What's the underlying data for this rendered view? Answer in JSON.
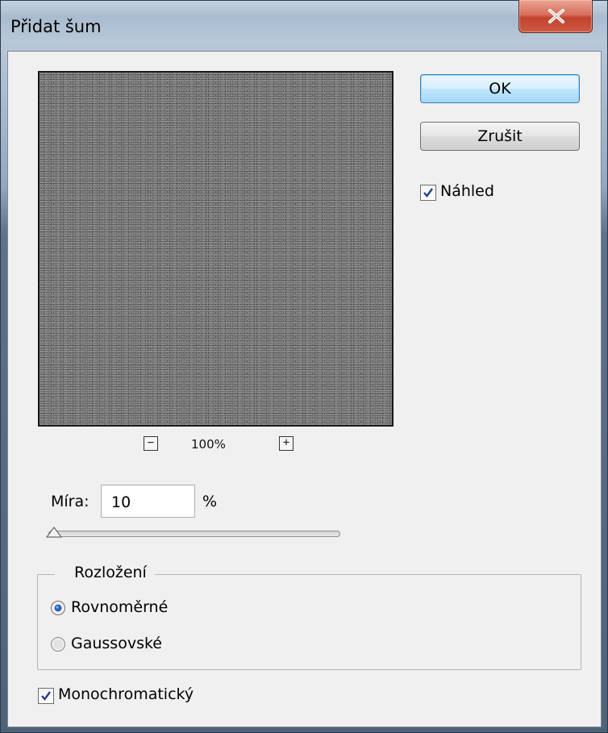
{
  "window": {
    "title": "Přidat šum"
  },
  "preview": {
    "zoom_level": "100%",
    "zoom_out": "−",
    "zoom_in": "+"
  },
  "buttons": {
    "ok": "OK",
    "cancel": "Zrušit"
  },
  "preview_checkbox": {
    "label": "Náhled",
    "checked": true
  },
  "amount": {
    "label": "Míra:",
    "value": "10",
    "unit": "%",
    "slider_fraction": 0.025
  },
  "distribution": {
    "legend": "Rozložení",
    "options": [
      {
        "label": "Rovnoměrné",
        "selected": true
      },
      {
        "label": "Gaussovské",
        "selected": false
      }
    ]
  },
  "monochromatic": {
    "label": "Monochromatický",
    "checked": true
  },
  "colors": {
    "ok_border": "#3c7fb1",
    "close_red": "#c0432f",
    "noise_base": "#6f6f6f"
  }
}
